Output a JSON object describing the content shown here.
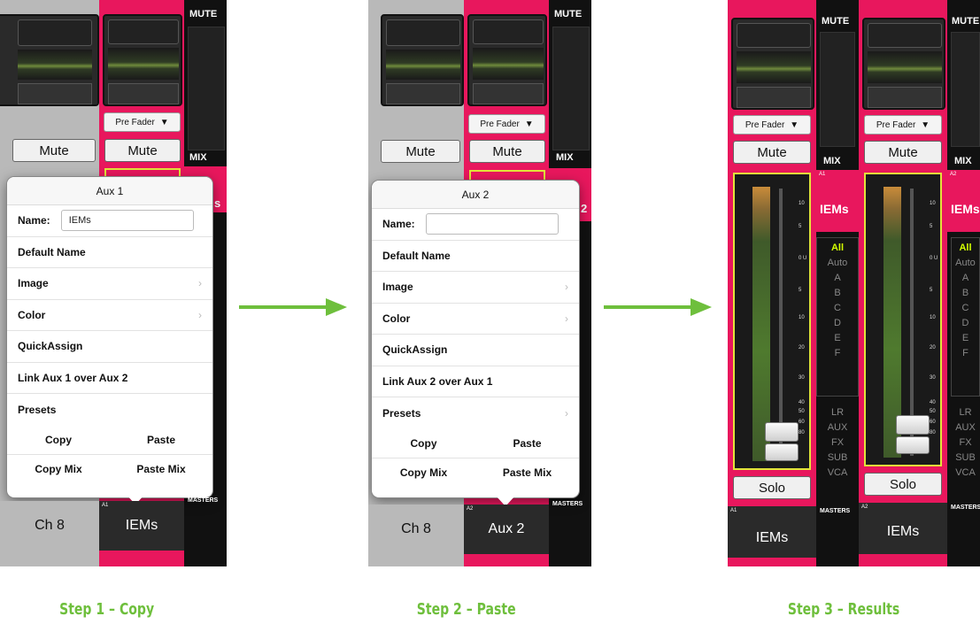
{
  "panel1": {
    "side_top": "MUTE",
    "side_mid": "MIX",
    "side_bottom": "MASTERS",
    "prefader": "Pre Fader",
    "mute_a": "Mute",
    "mute_b": "Mute",
    "tab_left": "Ch 8",
    "tab_right": "IEMs",
    "tab_right_tag": "A1",
    "popup": {
      "title": "Aux 1",
      "name_label": "Name:",
      "name_value": "IEMs",
      "rows": [
        "Default Name",
        "Image",
        "Color",
        "QuickAssign",
        "Link Aux 1 over Aux 2",
        "Presets"
      ],
      "copy": "Copy",
      "paste": "Paste",
      "copy_mix": "Copy Mix",
      "paste_mix": "Paste Mix"
    },
    "peek_text": "s"
  },
  "panel2": {
    "side_top": "MUTE",
    "side_mid": "MIX",
    "side_bottom": "MASTERS",
    "prefader": "Pre Fader",
    "mute_a": "Mute",
    "mute_b": "Mute",
    "tab_left": "Ch 8",
    "tab_right": "Aux 2",
    "tab_right_tag": "A2",
    "popup": {
      "title": "Aux 2",
      "name_label": "Name:",
      "name_value": "",
      "rows": [
        "Default Name",
        "Image",
        "Color",
        "QuickAssign",
        "Link Aux 2 over Aux 1",
        "Presets"
      ],
      "copy": "Copy",
      "paste": "Paste",
      "copy_mix": "Copy Mix",
      "paste_mix": "Paste Mix"
    },
    "peek_text": "2"
  },
  "panel3": {
    "side_top": "MUTE",
    "side_mid": "MIX",
    "side_bottom": "MASTERS",
    "strips": [
      {
        "tag": "A1",
        "prefader": "Pre Fader",
        "mute": "Mute",
        "solo": "Solo",
        "name": "IEMs",
        "mix_name": "IEMs"
      },
      {
        "tag": "A2",
        "prefader": "Pre Fader",
        "mute": "Mute",
        "solo": "Solo",
        "name": "IEMs",
        "mix_name": "IEMs"
      }
    ],
    "mix_list": [
      "All",
      "Auto",
      "A",
      "B",
      "C",
      "D",
      "E",
      "F"
    ],
    "mix_list_lower": [
      "LR",
      "AUX",
      "FX",
      "SUB",
      "VCA"
    ],
    "ticks": [
      "10",
      "5",
      "0 U",
      "5",
      "10",
      "20",
      "30",
      "40",
      "50",
      "60",
      "80"
    ]
  },
  "steps": [
    "Step 1 – Copy",
    "Step 2 – Paste",
    "Step 3 – Results"
  ],
  "colors": {
    "arrow": "#6ebf3c",
    "brand_pink": "#e8175d",
    "fader_outline": "#e2e43a",
    "selected": "#d4ff00"
  }
}
